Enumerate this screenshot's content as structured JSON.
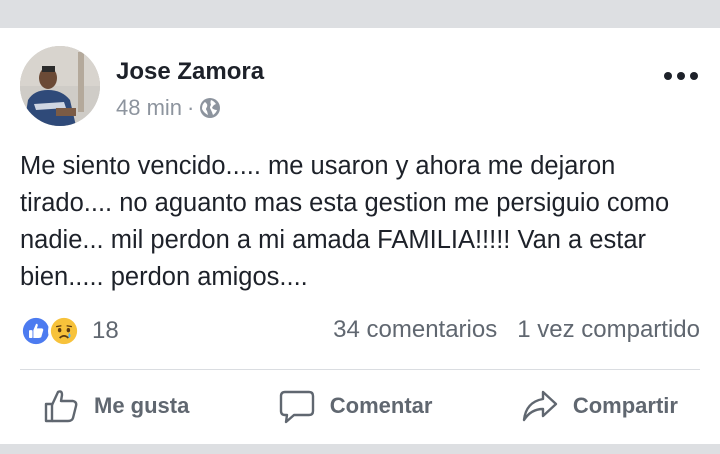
{
  "post": {
    "author": "Jose Zamora",
    "time": "48 min",
    "separator": "·",
    "privacy_icon": "globe-icon",
    "menu_icon": "more-options-icon",
    "text": "Me siento vencido..... me usaron y ahora me dejaron tirado.... no aguanto mas esta gestion me persiguio como nadie... mil perdon a mi amada FAMILIA!!!!! Van a estar bien..... perdon amigos...."
  },
  "reactions": {
    "icons": [
      "like-reaction-icon",
      "sad-reaction-icon"
    ],
    "count": "18",
    "comments": "34 comentarios",
    "shares": "1 vez compartido"
  },
  "actions": {
    "like": "Me gusta",
    "comment": "Comentar",
    "share": "Compartir"
  },
  "colors": {
    "like_blue": "#4c7bf0",
    "sad_yellow": "#f7c23b",
    "text_dark": "#1d2129",
    "text_gray": "#606770",
    "background": "#dddfe2"
  }
}
